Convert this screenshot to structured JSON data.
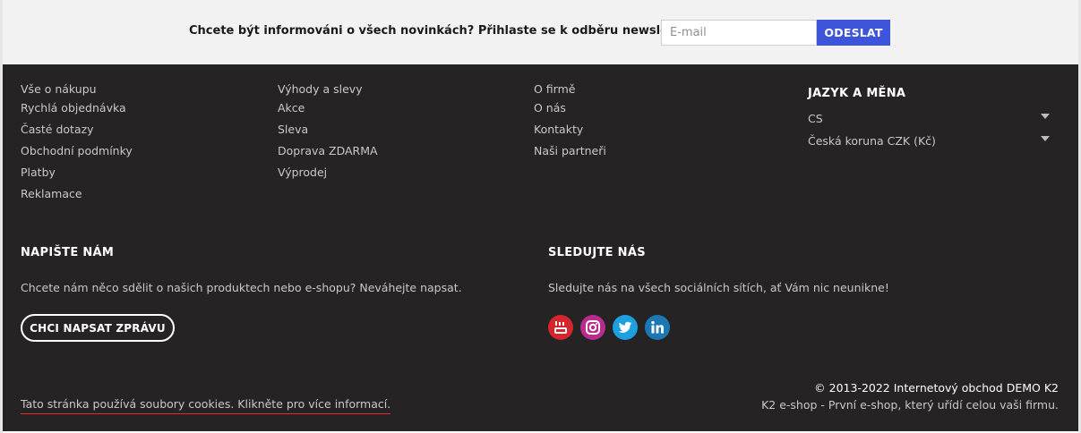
{
  "newsletter": {
    "text": "Chcete být informováni o všech novinkách? Přihlaste se k odběru newsletteru.",
    "email_placeholder": "E-mail",
    "submit_label": "ODESLAT"
  },
  "footer_links": {
    "column1": [
      "Vše o nákupu",
      "Rychlá objednávka",
      "Časté dotazy",
      "Obchodní podmínky",
      "Platby",
      "Reklamace"
    ],
    "column2": [
      "Výhody a slevy",
      "Akce",
      "Sleva",
      "Doprava ZDARMA",
      "Výprodej"
    ],
    "column3": [
      "O firmě",
      "O nás",
      "Kontakty",
      "Naši partneři"
    ]
  },
  "language_currency": {
    "title": "JAZYK A MĚNA",
    "language_value": "CS",
    "currency_value": "Česká koruna CZK (Kč)"
  },
  "write_us": {
    "title": "NAPIŠTE NÁM",
    "text": "Chcete nám něco sdělit o našich produktech nebo e-shopu? Neváhejte napsat.",
    "button_label": "CHCI NAPSAT ZPRÁVU"
  },
  "follow_us": {
    "title": "SLEDUJTE NÁS",
    "text": "Sledujte nás na všech sociálních sítích, ať Vám nic neunikne!",
    "icons": [
      "youtube-icon",
      "instagram-icon",
      "twitter-icon",
      "linkedin-icon"
    ]
  },
  "bottom": {
    "cookie_text": "Tato stránka používá soubory cookies. Klikněte pro více informací.",
    "copyright": "© 2013-2022 Internetový obchod DEMO K2",
    "tagline": "K2 e-shop - První e-shop, který uřídí celou vaši firmu."
  },
  "colors": {
    "footer_background": "#252323",
    "accent_button": "#3d55d9",
    "cookie_underline": "#e52b2b"
  }
}
